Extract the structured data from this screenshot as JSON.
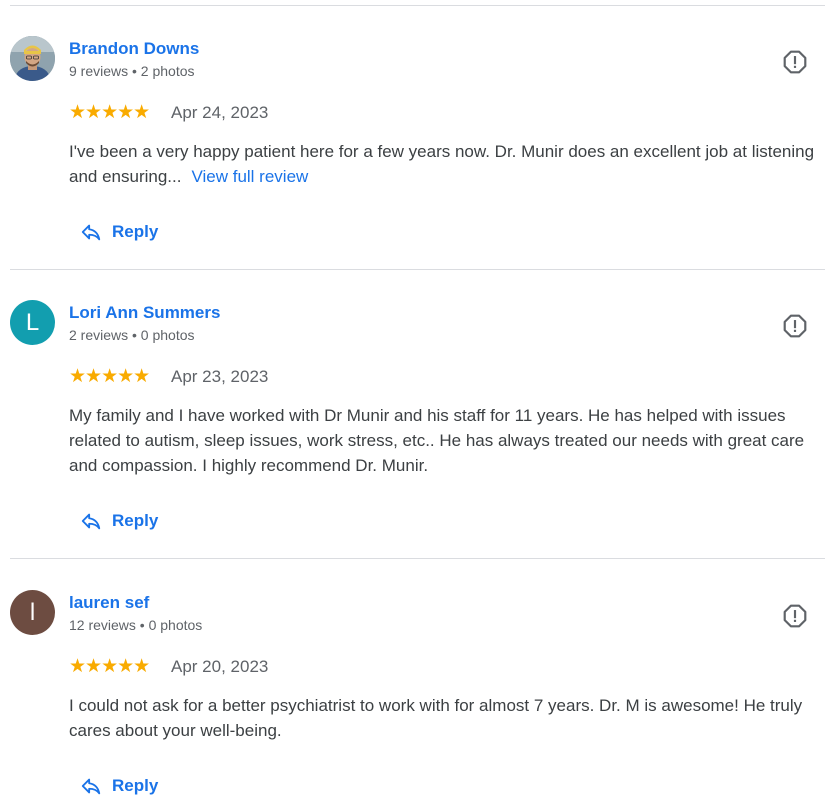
{
  "reviews": [
    {
      "name": "Brandon Downs",
      "meta": "9 reviews • 2 photos",
      "avatar_type": "photo",
      "avatar_letter": "",
      "avatar_color": "#7a8a96",
      "stars": "★★★★★",
      "rating": 5,
      "date": "Apr 24, 2023",
      "text": "I've been a very happy patient here for a few years now. Dr. Munir does an excellent job at listening and ensuring...",
      "more_label": "View full review",
      "reply_label": "Reply"
    },
    {
      "name": "Lori Ann Summers",
      "meta": "2 reviews • 0 photos",
      "avatar_type": "letter",
      "avatar_letter": "L",
      "avatar_color": "#129eaf",
      "stars": "★★★★★",
      "rating": 5,
      "date": "Apr 23, 2023",
      "text": "My family and I have worked with Dr Munir and his staff for 11 years. He has helped with issues related to autism, sleep issues, work stress, etc.. He has always treated our needs with great care and compassion. I highly recommend Dr. Munir.",
      "reply_label": "Reply"
    },
    {
      "name": "lauren sef",
      "meta": "12 reviews • 0 photos",
      "avatar_type": "letter",
      "avatar_letter": "l",
      "avatar_color": "#6d4c41",
      "stars": "★★★★★",
      "rating": 5,
      "date": "Apr 20, 2023",
      "text": "I could not ask for a better psychiatrist to work with for almost 7 years. Dr. M is awesome! He truly cares about your well-being.",
      "reply_label": "Reply"
    }
  ],
  "icons": {
    "report": "report-flag-icon",
    "reply": "reply-arrow-icon"
  },
  "colors": {
    "link": "#1a73e8",
    "star": "#f9ab00",
    "divider": "#dadce0",
    "secondary_text": "#5f6368"
  }
}
